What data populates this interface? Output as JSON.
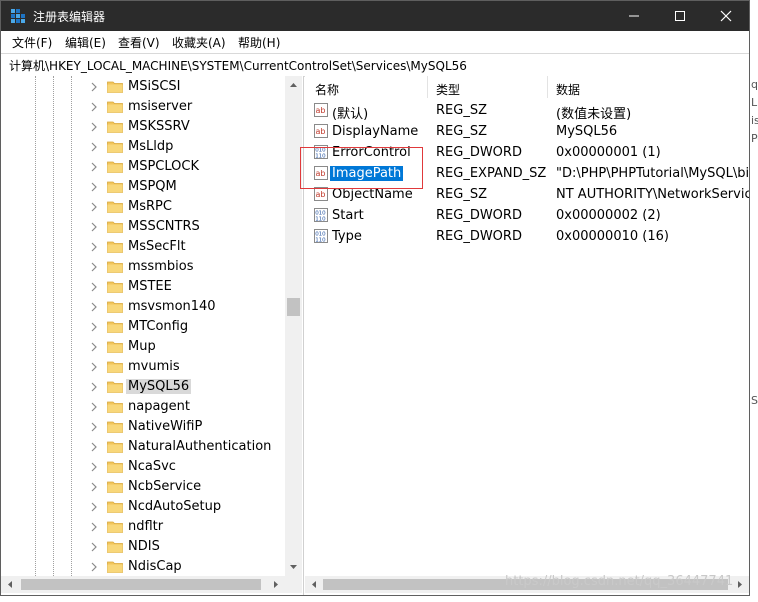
{
  "window": {
    "title": "注册表编辑器"
  },
  "window_controls": {
    "minimize": "—",
    "maximize": "☐",
    "close": "✕"
  },
  "menu": [
    {
      "label": "文件(F)"
    },
    {
      "label": "编辑(E)"
    },
    {
      "label": "查看(V)"
    },
    {
      "label": "收藏夹(A)"
    },
    {
      "label": "帮助(H)"
    }
  ],
  "address": {
    "path": "计算机\\HKEY_LOCAL_MACHINE\\SYSTEM\\CurrentControlSet\\Services\\MySQL56"
  },
  "tree": {
    "items": [
      {
        "label": "MSiSCSI"
      },
      {
        "label": "msiserver"
      },
      {
        "label": "MSKSSRV"
      },
      {
        "label": "MsLldp"
      },
      {
        "label": "MSPCLOCK"
      },
      {
        "label": "MSPQM"
      },
      {
        "label": "MsRPC"
      },
      {
        "label": "MSSCNTRS"
      },
      {
        "label": "MsSecFlt"
      },
      {
        "label": "mssmbios"
      },
      {
        "label": "MSTEE"
      },
      {
        "label": "msvsmon140"
      },
      {
        "label": "MTConfig"
      },
      {
        "label": "Mup"
      },
      {
        "label": "mvumis"
      },
      {
        "label": "MySQL56",
        "selected": true
      },
      {
        "label": "napagent"
      },
      {
        "label": "NativeWifiP"
      },
      {
        "label": "NaturalAuthentication"
      },
      {
        "label": "NcaSvc"
      },
      {
        "label": "NcbService"
      },
      {
        "label": "NcdAutoSetup"
      },
      {
        "label": "ndfltr"
      },
      {
        "label": "NDIS"
      },
      {
        "label": "NdisCap"
      }
    ]
  },
  "list": {
    "columns": [
      {
        "label": "名称"
      },
      {
        "label": "类型"
      },
      {
        "label": "数据"
      }
    ],
    "rows": [
      {
        "icon": "string-value-icon",
        "name": "(默认)",
        "type": "REG_SZ",
        "data": "(数值未设置)"
      },
      {
        "icon": "string-value-icon",
        "name": "DisplayName",
        "type": "REG_SZ",
        "data": "MySQL56"
      },
      {
        "icon": "binary-value-icon",
        "name": "ErrorControl",
        "type": "REG_DWORD",
        "data": "0x00000001 (1)"
      },
      {
        "icon": "string-value-icon",
        "name": "ImagePath",
        "type": "REG_EXPAND_SZ",
        "data": "\"D:\\PHP\\PHPTutorial\\MySQL\\bin\\m",
        "selected": true
      },
      {
        "icon": "string-value-icon",
        "name": "ObjectName",
        "type": "REG_SZ",
        "data": "NT AUTHORITY\\NetworkService"
      },
      {
        "icon": "binary-value-icon",
        "name": "Start",
        "type": "REG_DWORD",
        "data": "0x00000002 (2)"
      },
      {
        "icon": "binary-value-icon",
        "name": "Type",
        "type": "REG_DWORD",
        "data": "0x00000010 (16)"
      }
    ]
  },
  "watermark": "https://blog.csdn.net/qq_36447741",
  "background_fragments": [
    "q",
    "Li",
    "is",
    "Po",
    "S"
  ],
  "colors": {
    "titlebar": "#2b2b2b",
    "selection": "#0078d7",
    "folder": "#f2c55c",
    "highlight_box": "#e0393b"
  }
}
